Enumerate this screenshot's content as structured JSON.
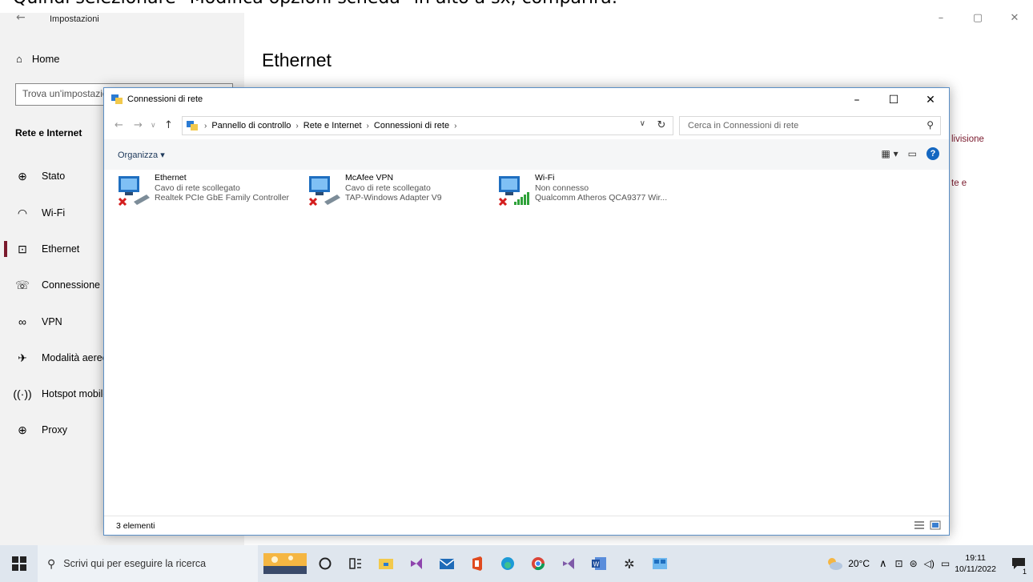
{
  "doc_caption": "Quindi selezionare \"Modifica opzioni scheda\" in alto a sx, comparirà:",
  "settings": {
    "title": "Impostazioni",
    "home": "Home",
    "search_placeholder": "Trova un'impostazione",
    "section": "Rete e Internet",
    "nav": [
      {
        "label": "Stato",
        "icon": "status-icon"
      },
      {
        "label": "Wi-Fi",
        "icon": "wifi-icon"
      },
      {
        "label": "Ethernet",
        "icon": "ethernet-icon",
        "active": true
      },
      {
        "label": "Connessione remota",
        "icon": "dialup-icon"
      },
      {
        "label": "VPN",
        "icon": "vpn-icon"
      },
      {
        "label": "Modalità aereo",
        "icon": "airplane-icon"
      },
      {
        "label": "Hotspot mobile",
        "icon": "hotspot-icon"
      },
      {
        "label": "Proxy",
        "icon": "globe-icon"
      }
    ],
    "page_heading": "Ethernet",
    "link_fragments": [
      "livisione",
      "te e"
    ],
    "accent": "#7a1a2d"
  },
  "explorer": {
    "title": "Connessioni di rete",
    "breadcrumb": [
      "Pannello di controllo",
      "Rete e Internet",
      "Connessioni di rete"
    ],
    "search_placeholder": "Cerca in Connessioni di rete",
    "organize": "Organizza ▾",
    "status_count": "3 elementi",
    "connections": [
      {
        "name": "Ethernet",
        "status": "Cavo di rete scollegato",
        "adapter": "Realtek PCIe GbE Family Controller",
        "icon": "wired-network-disconnected-icon"
      },
      {
        "name": "McAfee VPN",
        "status": "Cavo di rete scollegato",
        "adapter": "TAP-Windows Adapter V9",
        "icon": "wired-network-disconnected-icon"
      },
      {
        "name": "Wi-Fi",
        "status": "Non connesso",
        "adapter": "Qualcomm Atheros QCA9377 Wir...",
        "icon": "wireless-network-disconnected-icon"
      }
    ]
  },
  "taskbar": {
    "search_placeholder": "Scrivi qui per eseguire la ricerca",
    "weather": "20°C",
    "time": "19:11",
    "date": "10/11/2022",
    "notification_count": "1"
  }
}
